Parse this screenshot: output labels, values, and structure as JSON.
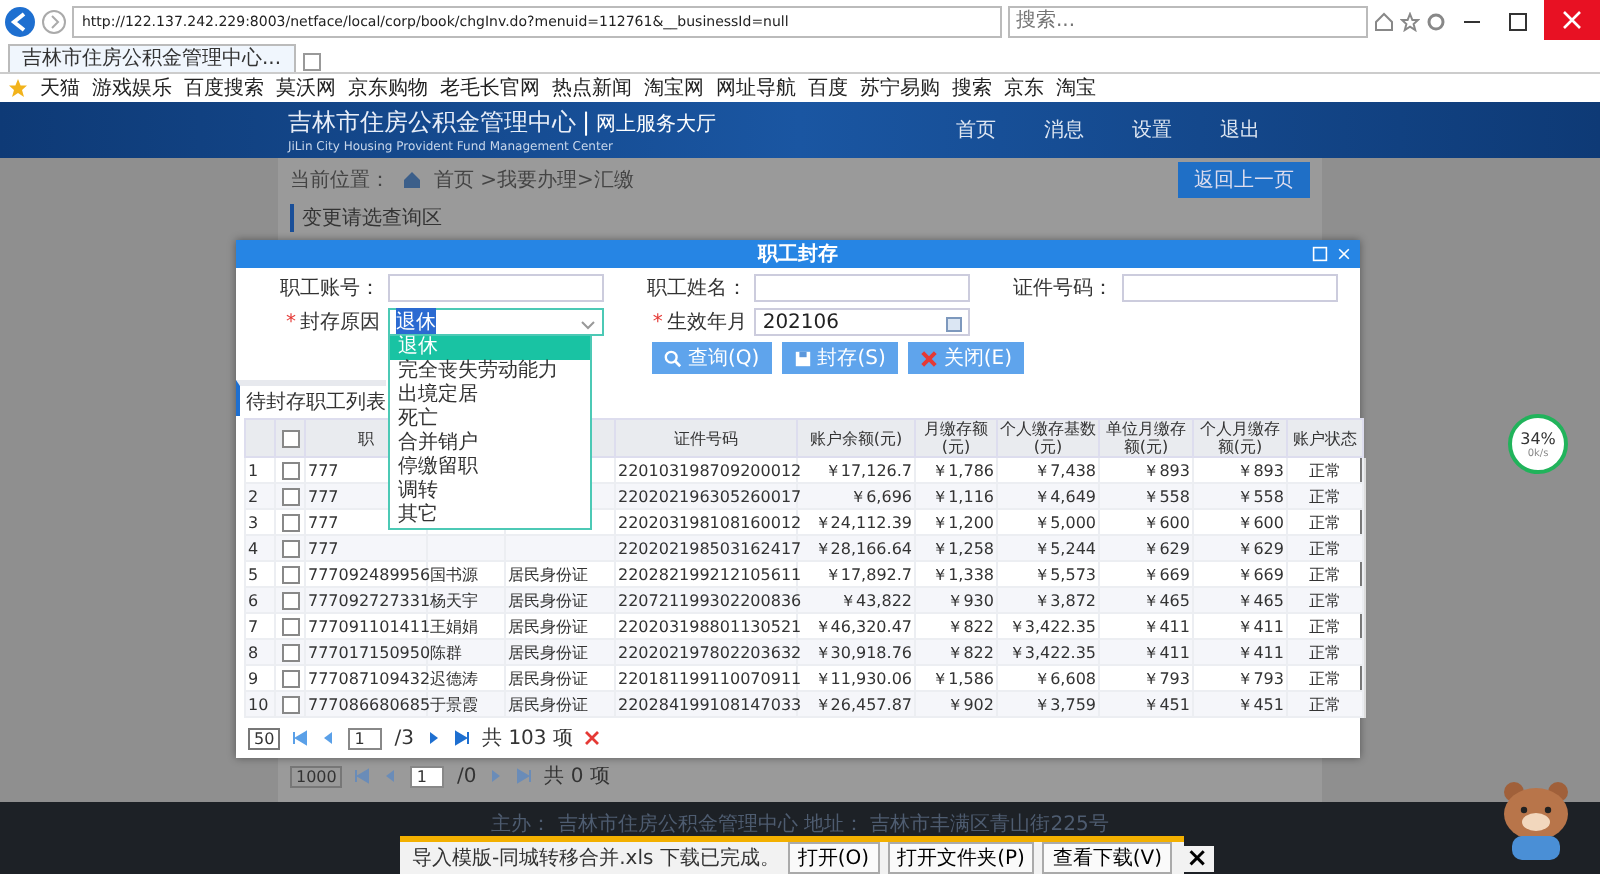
{
  "browser": {
    "url": "http://122.137.242.229:8003/netface/local/corp/book/chgInv.do?menuid=112761&__businessId=null",
    "search_placeholder": "搜索...",
    "tab_title": "吉林市住房公积金管理中心...",
    "favorites": [
      "天猫",
      "游戏娱乐",
      "百度搜索",
      "莫沃网",
      "京东购物",
      "老毛长官网",
      "热点新闻",
      "淘宝网",
      "网址导航",
      "百度",
      "苏宁易购",
      "搜索",
      "京东",
      "淘宝"
    ]
  },
  "header": {
    "title": "吉林市住房公积金管理中心",
    "divider": "|",
    "service": "网上服务大厅",
    "subtitle": "JiLin City Housing Provident Fund Management Center",
    "nav": [
      "首页",
      "消息",
      "设置",
      "退出"
    ]
  },
  "breadcrumb": {
    "label": "当前位置：",
    "path": "首页 >我要办理>汇缴"
  },
  "back_button": "返回上一页",
  "query_section": {
    "title": "变更请选查询区"
  },
  "background_pager": {
    "page_size": "1000",
    "page": "1",
    "pages": "/0",
    "total": "共 0 项"
  },
  "footer": {
    "text": "主办：  吉林市住房公积金管理中心  地址：  吉林市丰满区青山街225号"
  },
  "modal": {
    "title": "职工封存",
    "fields": [
      {
        "kind": "text",
        "label": "职工账号："
      },
      {
        "kind": "text",
        "label": "职工姓名："
      },
      {
        "kind": "text",
        "label": "证件号码："
      },
      {
        "kind": "select",
        "required_mark": "*",
        "label": "封存原因",
        "value": "退休"
      },
      {
        "kind": "date",
        "required_mark": "*",
        "label": "生效年月",
        "value": "202106"
      }
    ],
    "dropdown": {
      "options": [
        {
          "label": "退休",
          "selected": true
        },
        {
          "label": "完全丧失劳动能力",
          "selected": false
        },
        {
          "label": "出境定居",
          "selected": false
        },
        {
          "label": "死亡",
          "selected": false
        },
        {
          "label": "合并销户",
          "selected": false
        },
        {
          "label": "停缴留职",
          "selected": false
        },
        {
          "label": "调转",
          "selected": false
        },
        {
          "label": "其它",
          "selected": false
        }
      ]
    },
    "buttons": [
      {
        "kind": "search",
        "label": "查询(Q)"
      },
      {
        "kind": "save",
        "label": "封存(S)"
      },
      {
        "kind": "close",
        "label": "关闭(E)"
      }
    ],
    "list_title": "待封存职工列表",
    "table": {
      "select_all_checked": false,
      "columns": [
        "职",
        null,
        null,
        "证件号码",
        "账户余额(元)",
        "月缴存额(元)",
        "个人缴存基数(元)",
        "单位月缴存额(元)",
        "个人月缴存额(元)",
        "账户状态"
      ],
      "rows": [
        {
          "no": "1",
          "checked": false,
          "cells": [
            "777",
            null,
            null,
            "220103198709200012",
            "￥17,126.7",
            "￥1,786",
            "￥7,438",
            "￥893",
            "￥893",
            "正常"
          ]
        },
        {
          "no": "2",
          "checked": false,
          "cells": [
            "777",
            null,
            null,
            "220202196305260017",
            "￥6,696",
            "￥1,116",
            "￥4,649",
            "￥558",
            "￥558",
            "正常"
          ]
        },
        {
          "no": "3",
          "checked": false,
          "cells": [
            "777",
            null,
            null,
            "220203198108160012",
            "￥24,112.39",
            "￥1,200",
            "￥5,000",
            "￥600",
            "￥600",
            "正常"
          ]
        },
        {
          "no": "4",
          "checked": false,
          "cells": [
            "777",
            null,
            null,
            "220202198503162417",
            "￥28,166.64",
            "￥1,258",
            "￥5,244",
            "￥629",
            "￥629",
            "正常"
          ]
        },
        {
          "no": "5",
          "checked": false,
          "cells": [
            "777092489956",
            "国书源",
            "居民身份证",
            "220282199212105611",
            "￥17,892.7",
            "￥1,338",
            "￥5,573",
            "￥669",
            "￥669",
            "正常"
          ]
        },
        {
          "no": "6",
          "checked": false,
          "cells": [
            "777092727331",
            "杨天宇",
            "居民身份证",
            "220721199302200836",
            "￥43,822",
            "￥930",
            "￥3,872",
            "￥465",
            "￥465",
            "正常"
          ]
        },
        {
          "no": "7",
          "checked": false,
          "cells": [
            "777091101411",
            "王娟娟",
            "居民身份证",
            "220203198801130521",
            "￥46,320.47",
            "￥822",
            "￥3,422.35",
            "￥411",
            "￥411",
            "正常"
          ]
        },
        {
          "no": "8",
          "checked": false,
          "cells": [
            "777017150950",
            "陈群",
            "居民身份证",
            "220202197802203632",
            "￥30,918.76",
            "￥822",
            "￥3,422.35",
            "￥411",
            "￥411",
            "正常"
          ]
        },
        {
          "no": "9",
          "checked": false,
          "cells": [
            "777087109432",
            "迟德涛",
            "居民身份证",
            "220181199110070911",
            "￥11,930.06",
            "￥1,586",
            "￥6,608",
            "￥793",
            "￥793",
            "正常"
          ]
        },
        {
          "no": "10",
          "checked": false,
          "cells": [
            "777086680685",
            "于景霞",
            "居民身份证",
            "220284199108147033",
            "￥26,457.87",
            "￥902",
            "￥3,759",
            "￥451",
            "￥451",
            "正常"
          ]
        }
      ]
    },
    "pager": {
      "page_size": "50",
      "page": "1",
      "pages": "/3",
      "total": "共 103 项"
    }
  },
  "network_widget": {
    "percent": "34%",
    "speed": "0k/s"
  },
  "download_bar": {
    "message": "导入模版-同城转移合并.xls 下载已完成。",
    "buttons": [
      "打开(O)",
      "打开文件夹(P)",
      "查看下载(V)"
    ],
    "close": "×"
  }
}
